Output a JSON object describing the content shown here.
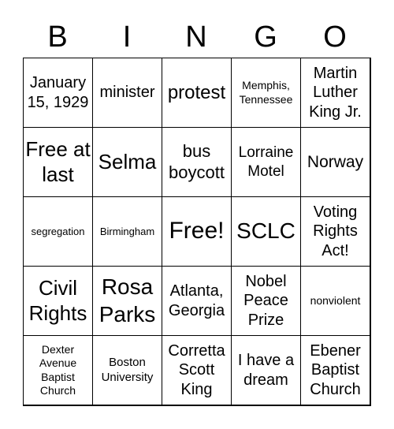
{
  "header": [
    "B",
    "I",
    "N",
    "G",
    "O"
  ],
  "cells": [
    "January 15, 1929",
    "minister",
    "protest",
    "Memphis, Tennessee",
    "Martin Luther King Jr.",
    "Free at last",
    "Selma",
    "bus boycott",
    "Lorraine Motel",
    "Norway",
    "segregation",
    "Birmingham",
    "Free!",
    "SCLC",
    "Voting Rights Act!",
    "Civil Rights",
    "Rosa Parks",
    "Atlanta, Georgia",
    "Nobel Peace Prize",
    "nonviolent",
    "Dexter Avenue Baptist Church",
    "Boston University",
    "Corretta Scott King",
    "I have a dream",
    "Ebener Baptist Church"
  ]
}
